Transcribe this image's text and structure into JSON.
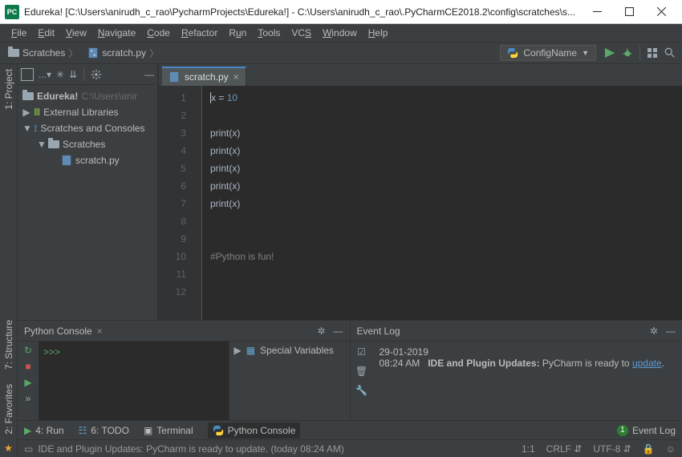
{
  "window": {
    "logo_text": "PC",
    "title": "Edureka! [C:\\Users\\anirudh_c_rao\\PycharmProjects\\Edureka!] - C:\\Users\\anirudh_c_rao\\.PyCharmCE2018.2\\config\\scratches\\s..."
  },
  "menubar": [
    "File",
    "Edit",
    "View",
    "Navigate",
    "Code",
    "Refactor",
    "Run",
    "Tools",
    "VCS",
    "Window",
    "Help"
  ],
  "breadcrumbs": {
    "root": "Scratches",
    "file": "scratch.py"
  },
  "run_config_label": "ConfigName",
  "project_tree": {
    "root": {
      "name": "Edureka!",
      "path": "C:\\Users\\anir"
    },
    "external_libs": "External Libraries",
    "scratches_root": "Scratches and Consoles",
    "scratches_folder": "Scratches",
    "scratch_file": "scratch.py"
  },
  "editor_tab": {
    "name": "scratch.py"
  },
  "code": {
    "lines": [
      1,
      2,
      3,
      4,
      5,
      6,
      7,
      8,
      9,
      10,
      11,
      12
    ],
    "l1_var": "x",
    "l1_eq": " = ",
    "l1_val": "10",
    "print_call": "print",
    "print_arg": "x",
    "comment": "#Python is fun!"
  },
  "python_console": {
    "title": "Python Console",
    "prompt": ">>>",
    "vars_label": "Special Variables"
  },
  "event_log": {
    "title": "Event Log",
    "date": "29-01-2019",
    "time": "08:24 AM",
    "msg_bold": "IDE and Plugin Updates:",
    "msg_rest": " PyCharm is ready to ",
    "link": "update"
  },
  "toolstrip": {
    "run": "4: Run",
    "todo": "6: TODO",
    "terminal": "Terminal",
    "python_console": "Python Console",
    "event_log": "Event Log",
    "badge": "1"
  },
  "statusbar": {
    "msg": "IDE and Plugin Updates: PyCharm is ready to update. (today 08:24 AM)",
    "pos": "1:1",
    "eol": "CRLF",
    "enc": "UTF-8"
  },
  "side_labels": {
    "project": "1: Project",
    "structure": "7: Structure",
    "favorites": "2: Favorites"
  }
}
